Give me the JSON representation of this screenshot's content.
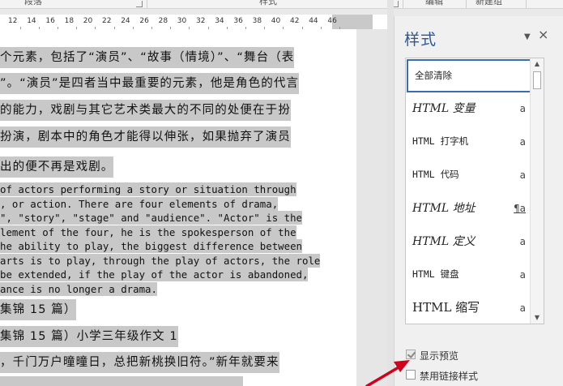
{
  "ribbon": {
    "groups": [
      "段落",
      "样式",
      "编辑",
      "新建组"
    ]
  },
  "ruler": {
    "numbers": [
      "12",
      "14",
      "16",
      "18",
      "20",
      "22",
      "24",
      "26",
      "28",
      "30",
      "32",
      "34",
      "36",
      "38",
      "40",
      "42",
      "44",
      "46"
    ]
  },
  "document": {
    "zh_lines": [
      "个元素，包括了“演员”、“故事（情境）”、“舞台（表",
      "”。“演员”是四者当中最重要的元素，他是角色的代言",
      "的能力，戏剧与其它艺术类最大的不同的处便在于扮",
      "扮演，剧本中的角色才能得以伸张，如果抛弃了演员",
      "出的便不再是戏剧。"
    ],
    "en_lines": [
      "of actors performing a story or situation through",
      ", or action. There are four elements of drama,",
      "\", \"story\", \"stage\" and \"audience\". \"Actor\" is the",
      "lement of the four, he is the spokesperson of the",
      "he ability to play, the biggest difference between",
      "arts is to play, through the play of actors, the role",
      "be extended, if the play of the actor is abandoned,",
      "ance is no longer a drama."
    ],
    "tail_lines": [
      "集锦 15 篇）",
      "集锦 15 篇）小学三年级作文 1",
      "，千门万户曈曈日，总把新桃换旧符。”新年就要来",
      ""
    ]
  },
  "styles_pane": {
    "title": "样式",
    "dropdown_glyph": "▼",
    "close_glyph": "×",
    "items": [
      {
        "name": "全部清除",
        "mark": ""
      },
      {
        "name": "HTML 变量",
        "mark": "a"
      },
      {
        "name": "HTML 打字机",
        "mark": "a"
      },
      {
        "name": "HTML 代码",
        "mark": "a"
      },
      {
        "name": "HTML 地址",
        "mark": "¶a"
      },
      {
        "name": "HTML 定义",
        "mark": "a"
      },
      {
        "name": "HTML 键盘",
        "mark": "a"
      },
      {
        "name": "HTML 缩写",
        "mark": "a"
      }
    ],
    "show_preview_label": "显示预览",
    "show_preview_checked": true,
    "disable_linked_label": "禁用链接样式",
    "disable_linked_checked": false
  },
  "colors": {
    "accent": "#2b579a",
    "highlight": "#c8c8c8",
    "annotation_arrow": "#d0021b"
  }
}
